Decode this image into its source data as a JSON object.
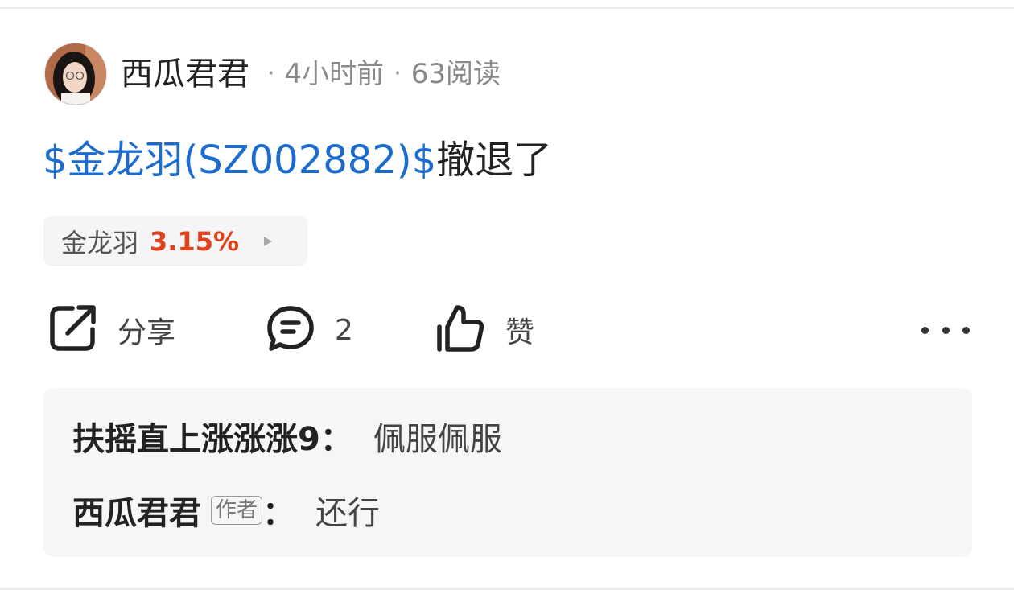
{
  "post": {
    "author": "西瓜君君",
    "time": "4小时前",
    "reads": "63阅读",
    "text_link": "$金龙羽(SZ002882)$",
    "text_rest": "撤退了"
  },
  "stock_chip": {
    "name": "金龙羽",
    "change": "3.15%",
    "change_color": "#e0421b"
  },
  "actions": {
    "share_label": "分享",
    "comment_count": "2",
    "like_label": "赞"
  },
  "comments": [
    {
      "name": "扶摇直上涨涨涨9",
      "colon": "：",
      "text": "佩服佩服"
    },
    {
      "name": "西瓜君君",
      "tag": "作者",
      "colon": "：",
      "text": "还行"
    }
  ],
  "colors": {
    "link": "#1c6ccf",
    "up_red": "#e0421b"
  }
}
